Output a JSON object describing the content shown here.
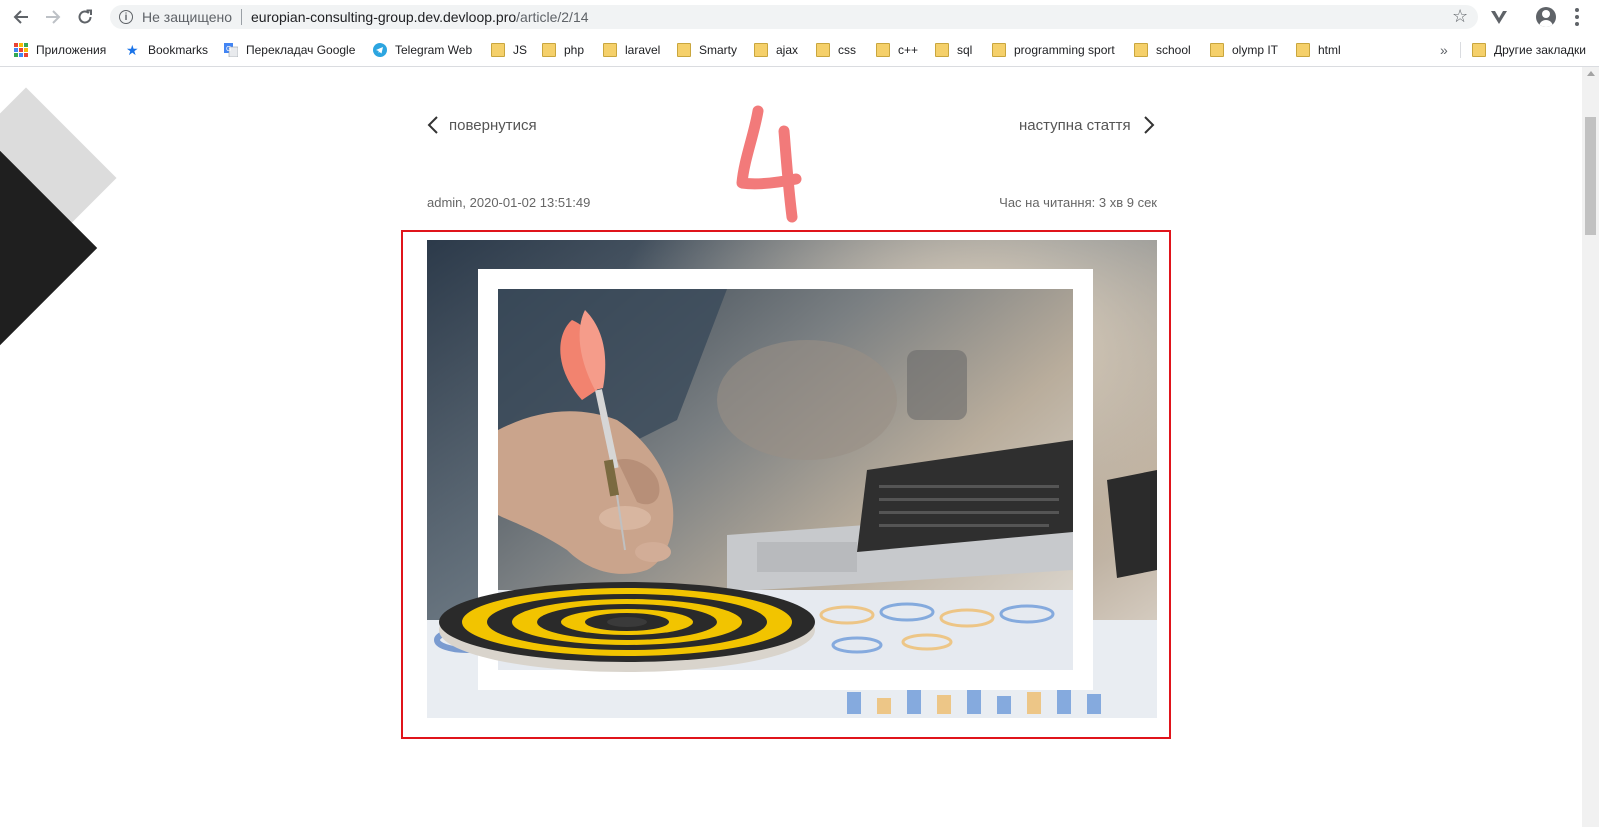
{
  "browser": {
    "insecure_label": "Не защищено",
    "url_host": "europian-consulting-group.dev.devloop.pro",
    "url_path": "/article/2/14"
  },
  "bookmarks": {
    "items": [
      {
        "label": "Приложения",
        "icon": "apps-grid-icon"
      },
      {
        "label": "Bookmarks",
        "icon": "star-icon"
      },
      {
        "label": "Перекладач Google",
        "icon": "google-translate-icon"
      },
      {
        "label": "Telegram Web",
        "icon": "telegram-icon"
      },
      {
        "label": "JS",
        "icon": "folder-icon"
      },
      {
        "label": "php",
        "icon": "folder-icon"
      },
      {
        "label": "laravel",
        "icon": "folder-icon"
      },
      {
        "label": "Smarty",
        "icon": "folder-icon"
      },
      {
        "label": "ajax",
        "icon": "folder-icon"
      },
      {
        "label": "css",
        "icon": "folder-icon"
      },
      {
        "label": "c++",
        "icon": "folder-icon"
      },
      {
        "label": "sql",
        "icon": "folder-icon"
      },
      {
        "label": "programming sport",
        "icon": "folder-icon"
      },
      {
        "label": "school",
        "icon": "folder-icon"
      },
      {
        "label": "olymp IT",
        "icon": "folder-icon"
      },
      {
        "label": "html",
        "icon": "folder-icon"
      }
    ],
    "overflow": "»",
    "other_bookmarks": "Другие закладки"
  },
  "article": {
    "back_label": "повернутися",
    "next_label": "наступна стаття",
    "author_date": "admin, 2020-01-02 13:51:49",
    "reading_time": "Час на читання: 3 хв 9 сек"
  },
  "annotation": {
    "number": "4",
    "color": "#f27a7a"
  },
  "colors": {
    "highlight_border": "#e0141b",
    "deco_dark": "#1f1f1f",
    "deco_gray": "#dcdcdc",
    "dartboard_yellow": "#f2c400"
  }
}
